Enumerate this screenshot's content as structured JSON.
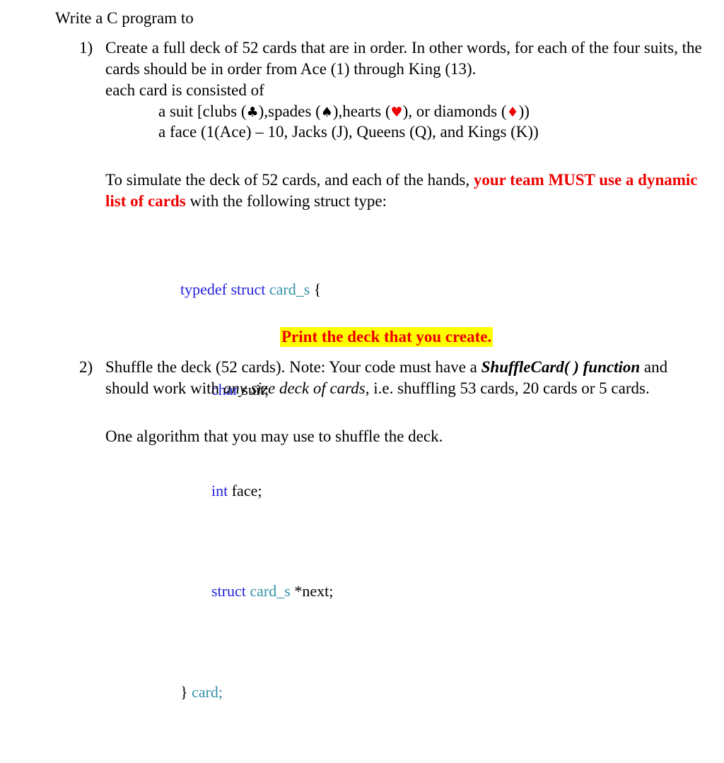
{
  "document": {
    "title": "Write a C program to",
    "background_color": "#ffffff",
    "text_color": "#000000"
  },
  "colors": {
    "red": "#ee0000",
    "highlight_yellow": "#ffff00",
    "code_keyword_blue": "#2222dd",
    "code_type_teal": "#3490a8",
    "black": "#000000"
  },
  "items": [
    {
      "marker": "1)",
      "lines": [
        "Create a full deck of 52 cards that are in order. In other words, for each of the four suits, the cards should be in order from Ace (1) through King (13).",
        "each card is consisted of"
      ],
      "sub_lines": [
        {
          "prefix": "a suit [clubs (",
          "club_symbol": "♣",
          "mid1": "),spades (",
          "spade_symbol": "♠",
          "mid2": "),hearts (",
          "heart_symbol": "♥",
          "mid3": "), or diamonds (",
          "diamond_symbol": "♦",
          "suffix": "))"
        },
        {
          "text": "a face (1(Ace) – 10, Jacks (J), Queens (Q), and Kings (K))"
        }
      ],
      "requirement": {
        "before": "To simulate the deck of 52 cards, and each of the hands, ",
        "emphasis": "your team MUST use a dynamic list of cards",
        "after": " with the following struct type:"
      },
      "code": {
        "lines": [
          [
            {
              "text": "typedef struct ",
              "style": "kw"
            },
            {
              "text": "card_s",
              "style": "type"
            },
            {
              "text": " {",
              "style": "plain"
            }
          ],
          [
            {
              "text": "        ",
              "style": "plain"
            },
            {
              "text": "char",
              "style": "kw"
            },
            {
              "text": " suit;",
              "style": "plain"
            }
          ],
          [
            {
              "text": "        ",
              "style": "plain"
            },
            {
              "text": "int",
              "style": "kw"
            },
            {
              "text": " face;",
              "style": "plain"
            }
          ],
          [
            {
              "text": "        ",
              "style": "plain"
            },
            {
              "text": "struct ",
              "style": "kw"
            },
            {
              "text": "card_s",
              "style": "type"
            },
            {
              "text": " *next;",
              "style": "plain"
            }
          ],
          [
            {
              "text": "} ",
              "style": "plain"
            },
            {
              "text": "card;",
              "style": "type"
            }
          ]
        ]
      },
      "highlighted_note": "Print the deck that you create."
    },
    {
      "marker": "2)",
      "rich_text": {
        "part1": "Shuffle the deck (52 cards).  Note: Your code must have a ",
        "bold_italic": "ShuffleCard( ) function",
        "part2": " and should work with ",
        "italic": "any size deck of cards",
        "part3": ", i.e. shuffling 53 cards, 20 cards or 5 cards."
      },
      "follow_up": "One algorithm that you may use to shuffle the deck."
    }
  ]
}
